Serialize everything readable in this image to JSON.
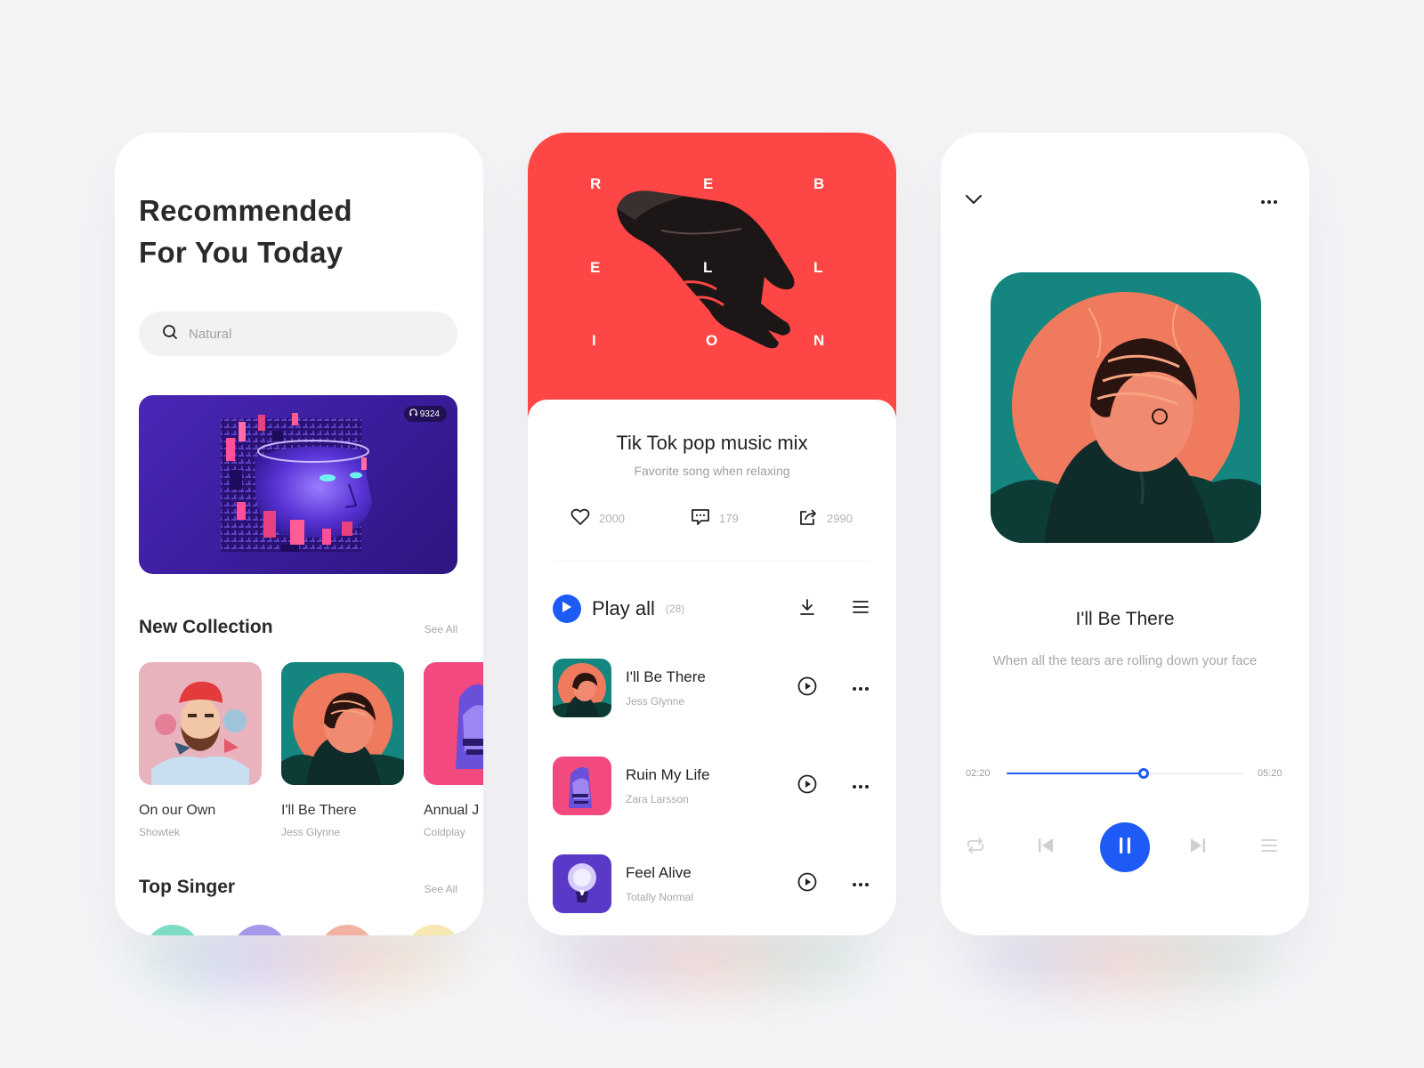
{
  "colors": {
    "accent": "#1e5bf6",
    "hero_red": "#ff4646",
    "background": "#f4f4f7"
  },
  "home": {
    "title_line1": "Recommended",
    "title_line2": "For You Today",
    "search": {
      "placeholder": "Natural",
      "icon": "search-icon"
    },
    "banner": {
      "listen_count": "9324",
      "icon": "headphones-icon"
    },
    "new_collection": {
      "title": "New Collection",
      "see_all": "See All",
      "items": [
        {
          "title": "On our Own",
          "artist": "Showtek"
        },
        {
          "title": "I'll Be There",
          "artist": "Jess Glynne"
        },
        {
          "title": "Annual J",
          "artist": "Coldplay"
        }
      ]
    },
    "top_singer": {
      "title": "Top Singer",
      "see_all": "See All"
    }
  },
  "playlist": {
    "hero_letters": [
      "R",
      "E",
      "B",
      "E",
      "L",
      "L",
      "I",
      "O",
      "N"
    ],
    "title": "Tik Tok pop music mix",
    "subtitle": "Favorite song when relaxing",
    "stats": {
      "likes": "2000",
      "comments": "179",
      "shares": "2990"
    },
    "play_all": {
      "label": "Play all",
      "count": "(28)"
    },
    "tracks": [
      {
        "title": "I'll Be There",
        "artist": "Jess Glynne"
      },
      {
        "title": "Ruin My Life",
        "artist": "Zara Larsson"
      },
      {
        "title": "Feel Alive",
        "artist": "Totally Normal"
      }
    ]
  },
  "now_playing": {
    "title": "I'll Be There",
    "lyric": "When all the tears are rolling down your face",
    "elapsed": "02:20",
    "duration": "05:20",
    "progress": 0.58,
    "state": "playing"
  }
}
